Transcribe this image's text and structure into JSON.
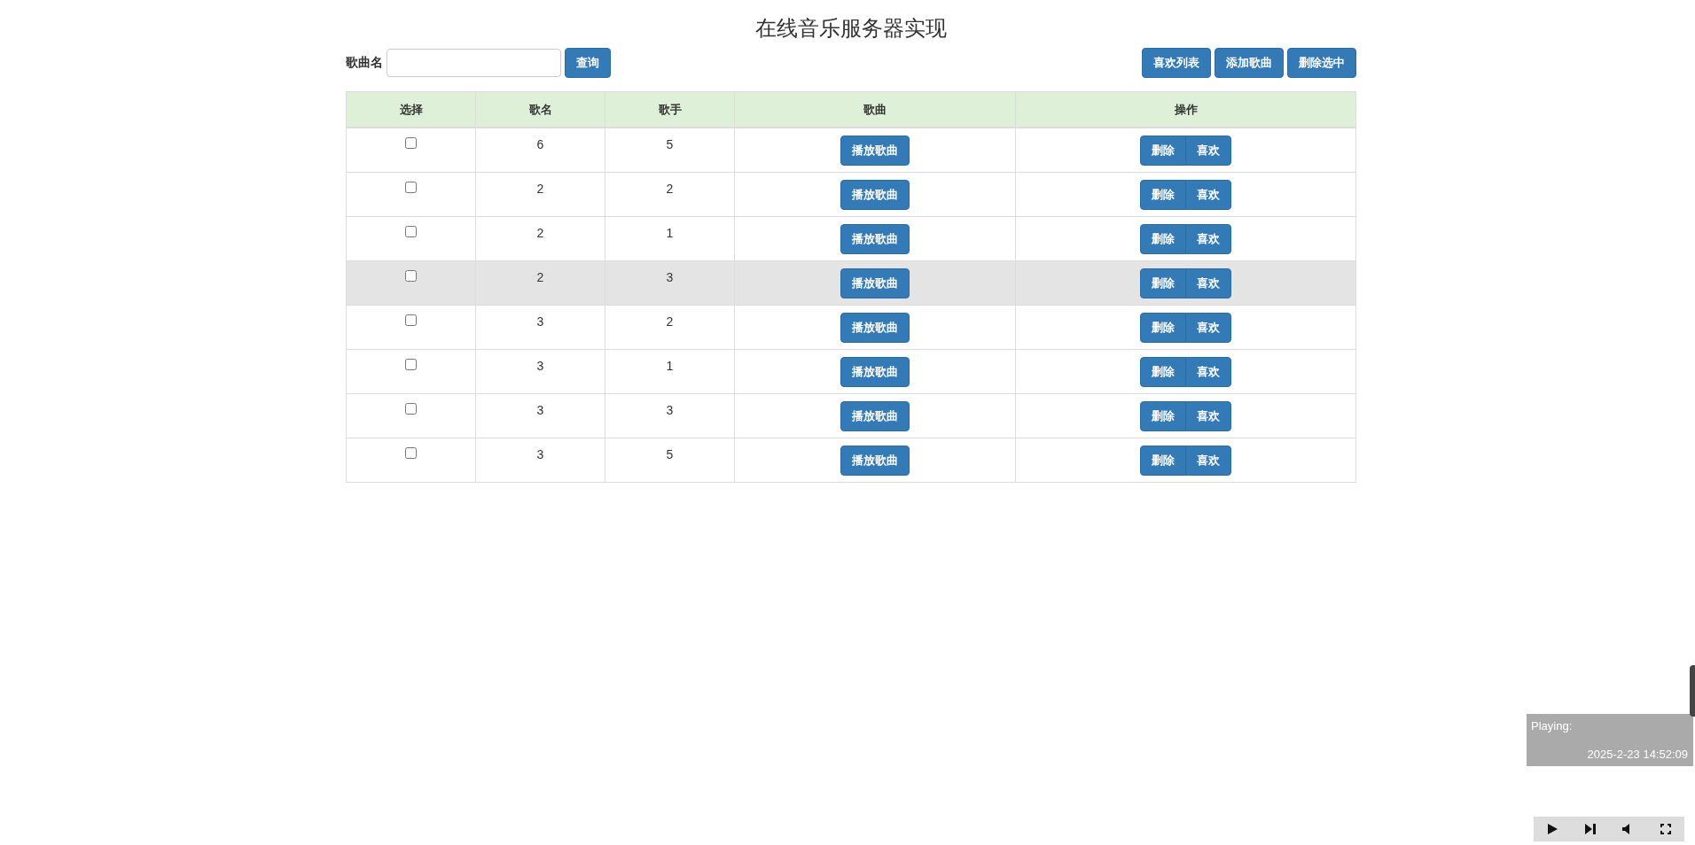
{
  "title": "在线音乐服务器实现",
  "search": {
    "label": "歌曲名",
    "button": "查询"
  },
  "toolbar_buttons": [
    "喜欢列表",
    "添加歌曲",
    "删除选中"
  ],
  "table": {
    "columns": [
      "选择",
      "歌名",
      "歌手",
      "歌曲",
      "操作"
    ],
    "rows": [
      {
        "checked": false,
        "highlighted": false,
        "name": "6",
        "singer": "5",
        "play": "播放歌曲",
        "actions": [
          "删除",
          "喜欢"
        ]
      },
      {
        "checked": false,
        "highlighted": false,
        "name": "2",
        "singer": "2",
        "play": "播放歌曲",
        "actions": [
          "删除",
          "喜欢"
        ]
      },
      {
        "checked": false,
        "highlighted": false,
        "name": "2",
        "singer": "1",
        "play": "播放歌曲",
        "actions": [
          "删除",
          "喜欢"
        ]
      },
      {
        "checked": false,
        "highlighted": true,
        "name": "2",
        "singer": "3",
        "play": "播放歌曲",
        "actions": [
          "删除",
          "喜欢"
        ]
      },
      {
        "checked": false,
        "highlighted": false,
        "name": "3",
        "singer": "2",
        "play": "播放歌曲",
        "actions": [
          "删除",
          "喜欢"
        ]
      },
      {
        "checked": false,
        "highlighted": false,
        "name": "3",
        "singer": "1",
        "play": "播放歌曲",
        "actions": [
          "删除",
          "喜欢"
        ]
      },
      {
        "checked": false,
        "highlighted": false,
        "name": "3",
        "singer": "3",
        "play": "播放歌曲",
        "actions": [
          "删除",
          "喜欢"
        ]
      },
      {
        "checked": false,
        "highlighted": false,
        "name": "3",
        "singer": "5",
        "play": "播放歌曲",
        "actions": [
          "删除",
          "喜欢"
        ]
      }
    ]
  },
  "player": {
    "status": "Playing:",
    "time": "2025-2-23 14:52:09"
  }
}
